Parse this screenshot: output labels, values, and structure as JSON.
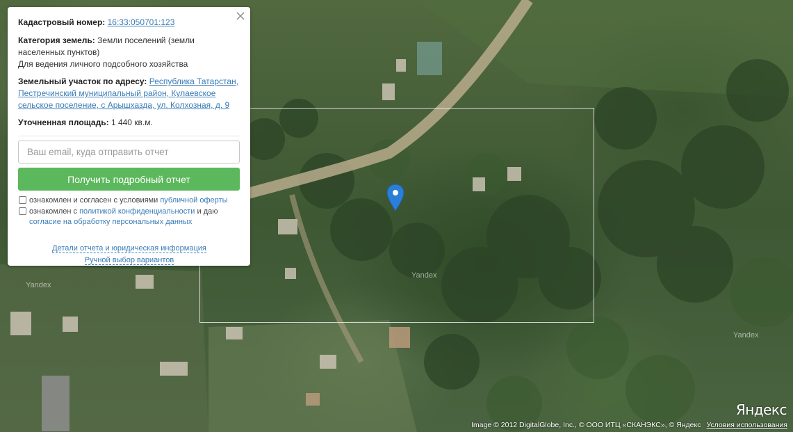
{
  "map": {
    "watermark": "Yandex",
    "logo": "Яндекс",
    "copyright": "Image © 2012 DigitalGlobe, Inc., © ООО ИТЦ «СКАНЭКС», © Яндекс",
    "terms_link": "Условия использования",
    "marker_icon": "map-pin-icon"
  },
  "panel": {
    "cadastral_label": "Кадастровый номер:",
    "cadastral_value": "16:33:050701:123",
    "category_label": "Категория земель:",
    "category_value": "Земли поселений (земли населенных пунктов)",
    "usage": "Для ведения личного подсобного хозяйства",
    "address_label": "Земельный участок по адресу:",
    "address_value": "Республика Татарстан, Пестречинский муниципальный район, Кулаевское сельское поселение, с Арышхазда, ул. Колхозная, д. 9",
    "area_label": "Уточненная площадь:",
    "area_value": "1 440 кв.м.",
    "email_placeholder": "Ваш email, куда отправить отчет",
    "submit_label": "Получить подробный отчет",
    "offer_text": "ознакомлен и согласен с условиями ",
    "offer_link": "публичной оферты",
    "privacy_text_1": "ознакомлен с ",
    "privacy_link": "политикой конфиденциальности",
    "privacy_text_2": " и даю",
    "consent_link": "согласие на обработку персональных данных",
    "details_link": "Детали отчета и юридическая информация",
    "manual_link": "Ручной выбор вариантов",
    "close_icon": "close-icon"
  }
}
